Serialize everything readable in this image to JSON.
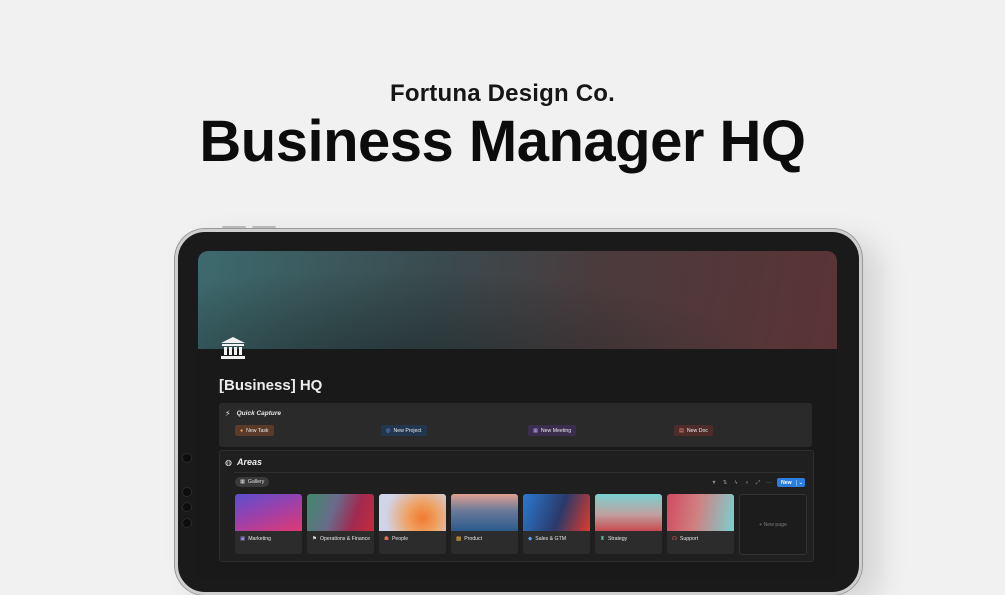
{
  "hero": {
    "subtitle": "Fortuna Design Co.",
    "title": "Business Manager HQ"
  },
  "page": {
    "icon": "bank-icon",
    "title": "[Business] HQ"
  },
  "quick_capture": {
    "icon": "bolt-icon",
    "title": "Quick Capture",
    "buttons": [
      {
        "label": "New Task",
        "icon": "check-circle-icon",
        "color": "#5a3a28"
      },
      {
        "label": "New Project",
        "icon": "target-icon",
        "color": "#233650"
      },
      {
        "label": "New Meeting",
        "icon": "calendar-icon",
        "color": "#3a2d4e"
      },
      {
        "label": "New Doc",
        "icon": "document-icon",
        "color": "#4e2c2a"
      }
    ]
  },
  "areas": {
    "icon": "globe-icon",
    "title": "Areas",
    "view_tab": "Gallery",
    "new_button": "New",
    "new_page": "+ New page",
    "cards": [
      {
        "label": "Marketing",
        "icon": "megaphone-icon",
        "gradient": [
          "#5a4fd0",
          "#e03a72"
        ]
      },
      {
        "label": "Operations & Finance",
        "icon": "flag-icon",
        "gradient": [
          "#3e8a6a",
          "#c82a3c"
        ]
      },
      {
        "label": "People",
        "icon": "people-icon",
        "gradient": [
          "#c8d0e8",
          "#f07a30"
        ]
      },
      {
        "label": "Product",
        "icon": "box-icon",
        "gradient": [
          "#2a5a8a",
          "#e0a090"
        ]
      },
      {
        "label": "Sales & GTM",
        "icon": "tag-icon",
        "gradient": [
          "#2a7ad0",
          "#e03a2a"
        ]
      },
      {
        "label": "Strategy",
        "icon": "chess-icon",
        "gradient": [
          "#7ad0d0",
          "#c84a50"
        ]
      },
      {
        "label": "Support",
        "icon": "headset-icon",
        "gradient": [
          "#d04a60",
          "#7ad0d0"
        ]
      }
    ]
  }
}
